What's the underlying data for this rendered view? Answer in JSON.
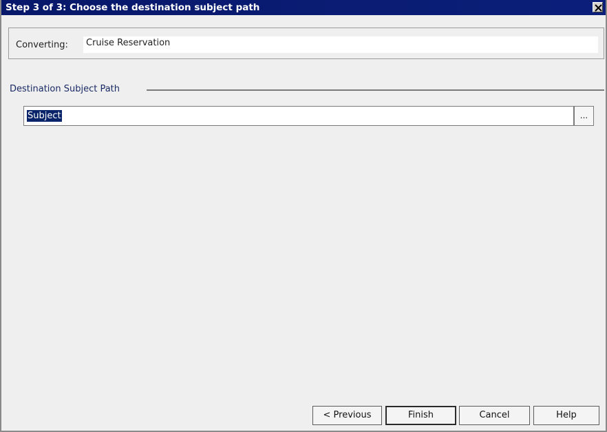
{
  "window": {
    "title": "Step 3 of 3: Choose the destination subject path",
    "close_icon": "close-x-icon"
  },
  "converting": {
    "label": "Converting:",
    "value": "Cruise Reservation"
  },
  "destination": {
    "section_label": "Destination Subject Path",
    "path_value": "Subject",
    "browse_label": "..."
  },
  "buttons": {
    "previous": "< Previous",
    "finish": "Finish",
    "cancel": "Cancel",
    "help": "Help"
  },
  "colors": {
    "titlebar": "#0a1a6b",
    "selection": "#0a246a",
    "section_label": "#1a2a66"
  }
}
